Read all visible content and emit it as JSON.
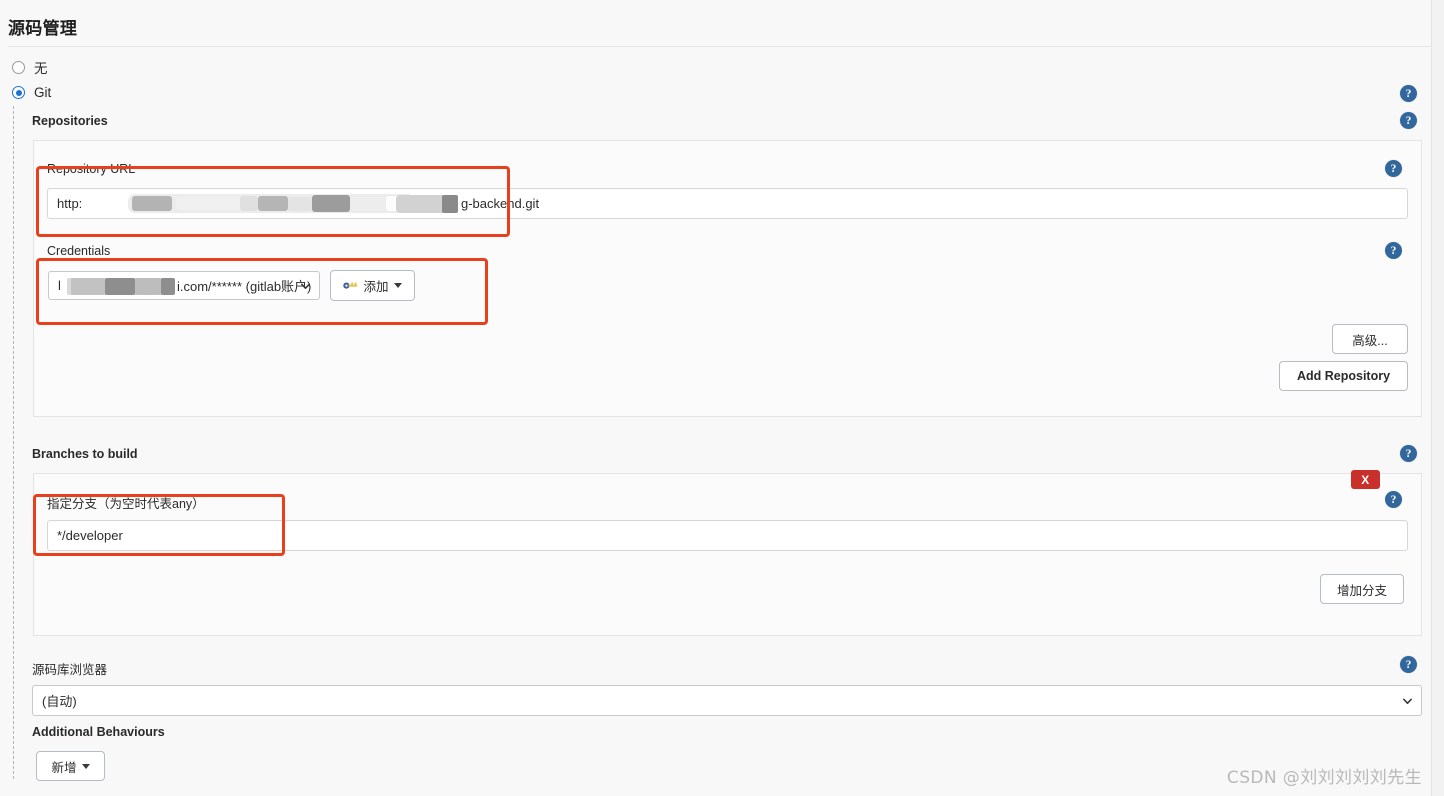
{
  "page": {
    "section_title": "源码管理",
    "watermark": "CSDN @刘刘刘刘刘先生"
  },
  "scm_options": [
    {
      "label": "无",
      "checked": false
    },
    {
      "label": "Git",
      "checked": true
    }
  ],
  "git": {
    "repositories_label": "Repositories",
    "repository": {
      "url_label": "Repository URL",
      "url_value_prefix": "http:",
      "url_value_suffix": "g-backend.git",
      "credentials_label": "Credentials",
      "credentials_value_prefix": "l",
      "credentials_value_suffix": "i.com/****** (gitlab账户)",
      "advanced_button": "高级...",
      "add_repository_button": "Add Repository",
      "add_credentials_button": "添加"
    },
    "branches": {
      "label": "Branches to build",
      "specifier_label": "指定分支（为空时代表any）",
      "specifier_value": "*/developer",
      "add_branch_button": "增加分支",
      "delete_badge": "X"
    },
    "browser": {
      "label": "源码库浏览器",
      "selected": "(自动)"
    },
    "additional_behaviours": {
      "label": "Additional Behaviours",
      "add_button": "新增"
    }
  },
  "icons": {
    "help": "?",
    "key": "key-icon",
    "chevron": "chevron-down-icon"
  },
  "colors": {
    "accent_blue": "#1a73d6",
    "help_blue": "#31679c",
    "danger_red": "#c9302c",
    "annotation_red": "#e8401c"
  }
}
